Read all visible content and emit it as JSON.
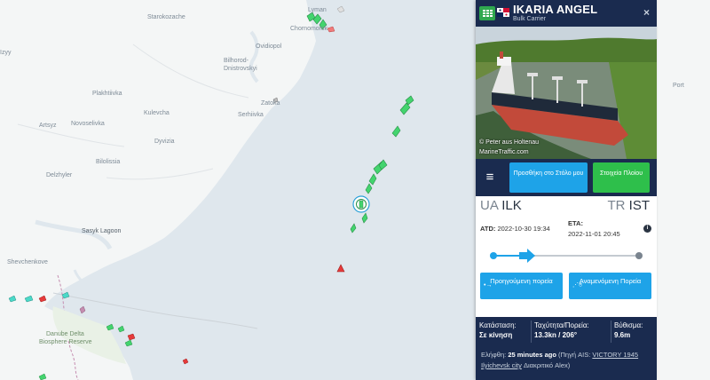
{
  "map": {
    "places": [
      {
        "name": "Starokozache",
        "cls": ""
      },
      {
        "name": "Lyman",
        "cls": ""
      },
      {
        "name": "Chornomorsk",
        "cls": ""
      },
      {
        "name": "Ovidiopol",
        "cls": ""
      },
      {
        "name": "Bilhorod-Dnistrovskyi",
        "cls": ""
      },
      {
        "name": "Plakhtiivka",
        "cls": ""
      },
      {
        "name": "Kulevcha",
        "cls": ""
      },
      {
        "name": "Serhiivka",
        "cls": ""
      },
      {
        "name": "Zatoka",
        "cls": ""
      },
      {
        "name": "Novoselivka",
        "cls": ""
      },
      {
        "name": "Artsyz",
        "cls": ""
      },
      {
        "name": "Dyvizia",
        "cls": ""
      },
      {
        "name": "Bilolissia",
        "cls": ""
      },
      {
        "name": "Delzhyler",
        "cls": ""
      },
      {
        "name": "Sasyk Lagoon",
        "cls": "dark"
      },
      {
        "name": "Shevchenkove",
        "cls": ""
      },
      {
        "name": "Danube Delta",
        "cls": "reserve"
      },
      {
        "name": "Biosphere Reserve",
        "cls": "reserve"
      },
      {
        "name": "Izyy",
        "cls": ""
      },
      {
        "name": "Port",
        "cls": ""
      }
    ]
  },
  "panel": {
    "ship_name": "IKARIA ANGEL",
    "ship_type": "Bulk Carrier",
    "close_label": "×",
    "grid_icon": "grid-icon",
    "flag": {
      "name": "flag-panama",
      "colors": [
        "#ffffff",
        "#d21034",
        "#072357"
      ]
    },
    "photo": {
      "credit": "© Peter aus Holtenau",
      "site": "MarineTraffic.com"
    },
    "actions": {
      "menu_icon": "≡",
      "add_fleet": "Προσθήκη στο Στόλο μου",
      "vessel_details": "Στοιχεία Πλοίου"
    },
    "voyage": {
      "dep_cc": "UA",
      "dep_port": "ILK",
      "arr_cc": "TR",
      "arr_port": "IST",
      "atd_label": "ATD:",
      "atd_value": "2022-10-30 19:34",
      "eta_label": "ETA:",
      "eta_value": "2022-11-01 20:45",
      "progress": 0.2,
      "prev_route": "Προηγούμενη πορεία",
      "next_route": "Αναμενόμενη Πορεία"
    },
    "stats": {
      "status_label": "Κατάσταση:",
      "status_value": "Σε κίνηση",
      "speed_label": "Ταχύτητα/Πορεία:",
      "speed_value": "13.3kn / 206°",
      "draught_label": "Βύθισμα:",
      "draught_value": "9.6m"
    },
    "footer": {
      "received_prefix": "Ελήφθη:",
      "received_value": "25 minutes ago",
      "source_prefix": "(Πηγή AIS:",
      "source_value": "VICTORY 1945 Ilyichevsk city",
      "source_suffix": "Διακριτικό Alex)"
    },
    "colors": {
      "navy": "#1a2b4f",
      "blue": "#1ea3e8",
      "green": "#2ebf4b"
    }
  }
}
